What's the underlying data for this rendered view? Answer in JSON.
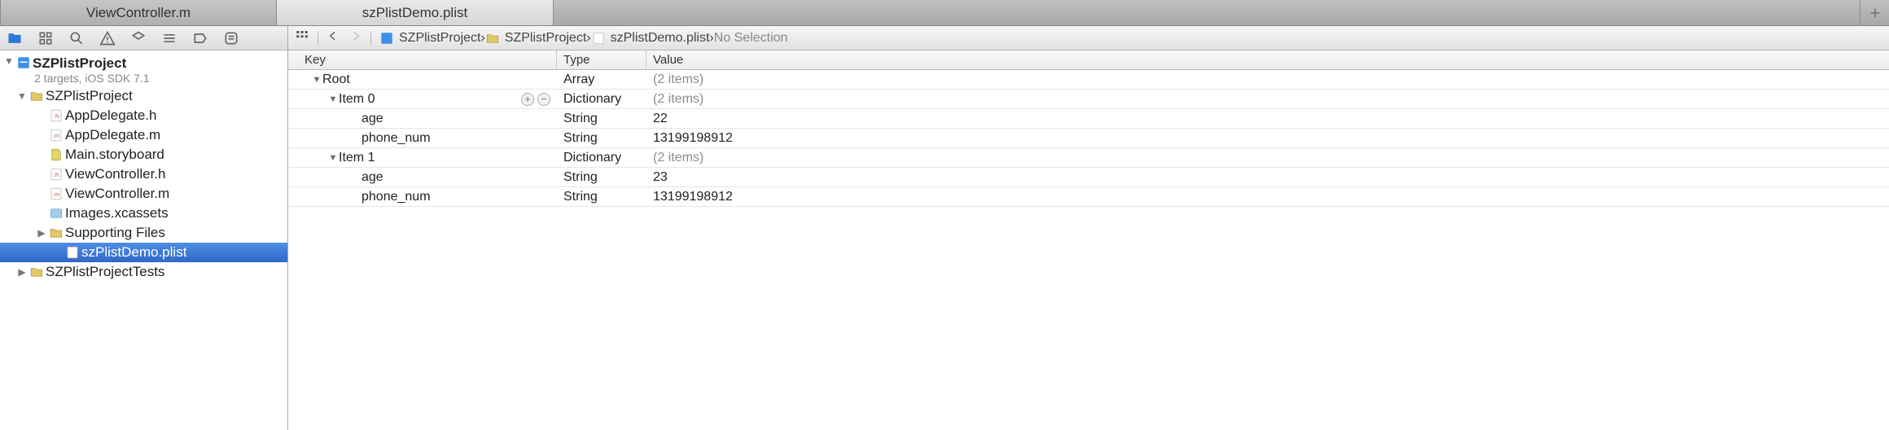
{
  "tabs": [
    {
      "label": "ViewController.m",
      "active": false
    },
    {
      "label": "szPlistDemo.plist",
      "active": true
    }
  ],
  "sidebar": {
    "project_name": "SZPlistProject",
    "project_subtitle": "2 targets, iOS SDK 7.1",
    "items": [
      {
        "label": "SZPlistProject",
        "icon": "folder",
        "indent": 1,
        "discl": "down"
      },
      {
        "label": "AppDelegate.h",
        "icon": "h",
        "indent": 2
      },
      {
        "label": "AppDelegate.m",
        "icon": "m",
        "indent": 2
      },
      {
        "label": "Main.storyboard",
        "icon": "story",
        "indent": 2
      },
      {
        "label": "ViewController.h",
        "icon": "h",
        "indent": 2
      },
      {
        "label": "ViewController.m",
        "icon": "m",
        "indent": 2
      },
      {
        "label": "Images.xcassets",
        "icon": "assets",
        "indent": 2
      },
      {
        "label": "Supporting Files",
        "icon": "folder",
        "indent": 2,
        "discl": "right"
      },
      {
        "label": "szPlistDemo.plist",
        "icon": "plist",
        "indent": 3,
        "selected": true
      },
      {
        "label": "SZPlistProjectTests",
        "icon": "folder",
        "indent": 1,
        "discl": "right"
      }
    ]
  },
  "jumpbar": {
    "crumbs": [
      {
        "icon": "proj",
        "label": "SZPlistProject"
      },
      {
        "icon": "folder",
        "label": "SZPlistProject"
      },
      {
        "icon": "plist",
        "label": "szPlistDemo.plist"
      },
      {
        "label": "No Selection",
        "muted": true
      }
    ]
  },
  "plist": {
    "columns": {
      "key": "Key",
      "type": "Type",
      "value": "Value"
    },
    "rows": [
      {
        "key": "Root",
        "type": "Array",
        "value": "(2 items)",
        "muted_value": true,
        "indent": 0,
        "discl": "down"
      },
      {
        "key": "Item 0",
        "type": "Dictionary",
        "value": "(2 items)",
        "muted_value": true,
        "indent": 1,
        "discl": "down",
        "hover": true
      },
      {
        "key": "age",
        "type": "String",
        "value": "22",
        "indent": 2
      },
      {
        "key": "phone_num",
        "type": "String",
        "value": "13199198912",
        "indent": 2
      },
      {
        "key": "Item 1",
        "type": "Dictionary",
        "value": "(2 items)",
        "muted_value": true,
        "indent": 1,
        "discl": "down"
      },
      {
        "key": "age",
        "type": "String",
        "value": "23",
        "indent": 2
      },
      {
        "key": "phone_num",
        "type": "String",
        "value": "13199198912",
        "indent": 2
      }
    ]
  }
}
